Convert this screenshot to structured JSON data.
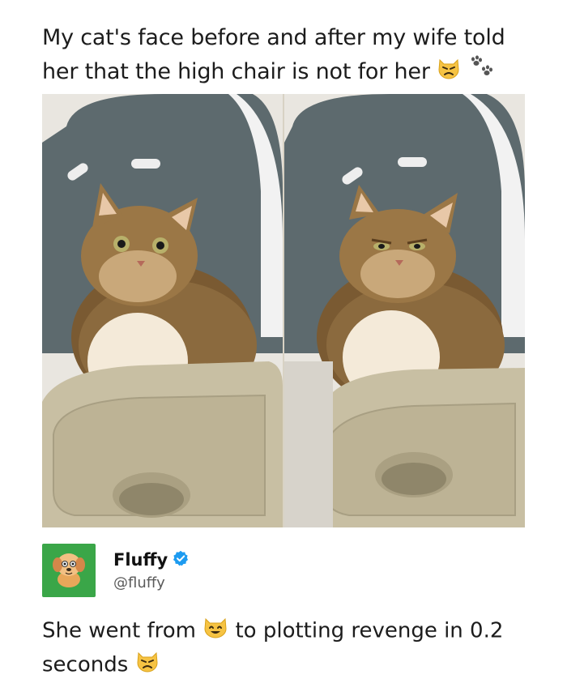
{
  "post": {
    "title_text": "My cat's face before and after my wife told her that the high chair is not for her",
    "title_emojis": [
      "pouting-cat-icon",
      "paw-prints-icon"
    ]
  },
  "photos": {
    "panels": [
      "before",
      "after"
    ]
  },
  "author": {
    "name": "Fluffy",
    "handle": "@fluffy",
    "verified": true,
    "avatar_icon": "dog-avatar-icon",
    "avatar_bg": "#3aa648"
  },
  "tweet": {
    "text_part1": "She went from",
    "text_part2": "to plotting revenge in 0.2",
    "text_part3": "seconds",
    "emojis": [
      "smiling-cat-icon",
      "pouting-cat-icon"
    ]
  },
  "colors": {
    "verified_blue": "#1d9bf0",
    "emoji_yellow": "#f6c343"
  }
}
